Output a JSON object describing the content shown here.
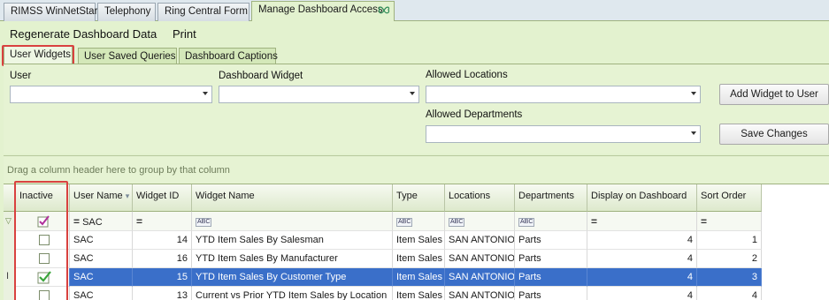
{
  "doc_tabs": [
    "RIMSS WinNetStar",
    "Telephony",
    "Ring Central Form",
    "Manage Dashboard Access"
  ],
  "menu": {
    "regenerate": "Regenerate Dashboard Data",
    "print": "Print"
  },
  "inner_tabs": [
    "User Widgets",
    "User Saved Queries",
    "Dashboard Captions"
  ],
  "form": {
    "user_label": "User",
    "widget_label": "Dashboard Widget",
    "locations_label": "Allowed Locations",
    "departments_label": "Allowed Departments",
    "add_button": "Add Widget to User",
    "save_button": "Save Changes"
  },
  "group_hint": "Drag a column header here to group by that column",
  "grid": {
    "columns": [
      "Inactive",
      "User Name",
      "Widget ID",
      "Widget Name",
      "Type",
      "Locations",
      "Departments",
      "Display on Dashboard",
      "Sort Order"
    ],
    "filter": {
      "user": "SAC"
    },
    "rows": [
      {
        "inactive": false,
        "user": "SAC",
        "id": "14",
        "name": "YTD Item Sales By Salesman",
        "type": "Item Sales",
        "loc": "SAN ANTONIO",
        "dept": "Parts",
        "display": "4",
        "sort": "1",
        "selected": false
      },
      {
        "inactive": false,
        "user": "SAC",
        "id": "16",
        "name": "YTD Item Sales By Manufacturer",
        "type": "Item Sales",
        "loc": "SAN ANTONIO",
        "dept": "Parts",
        "display": "4",
        "sort": "2",
        "selected": false
      },
      {
        "inactive": true,
        "user": "SAC",
        "id": "15",
        "name": "YTD Item Sales By Customer Type",
        "type": "Item Sales",
        "loc": "SAN ANTONIO",
        "dept": "Parts",
        "display": "4",
        "sort": "3",
        "selected": true
      },
      {
        "inactive": false,
        "user": "SAC",
        "id": "13",
        "name": "Current vs Prior YTD Item Sales by Location",
        "type": "Item Sales",
        "loc": "SAN ANTONIO",
        "dept": "Parts",
        "display": "4",
        "sort": "4",
        "selected": false
      }
    ]
  }
}
